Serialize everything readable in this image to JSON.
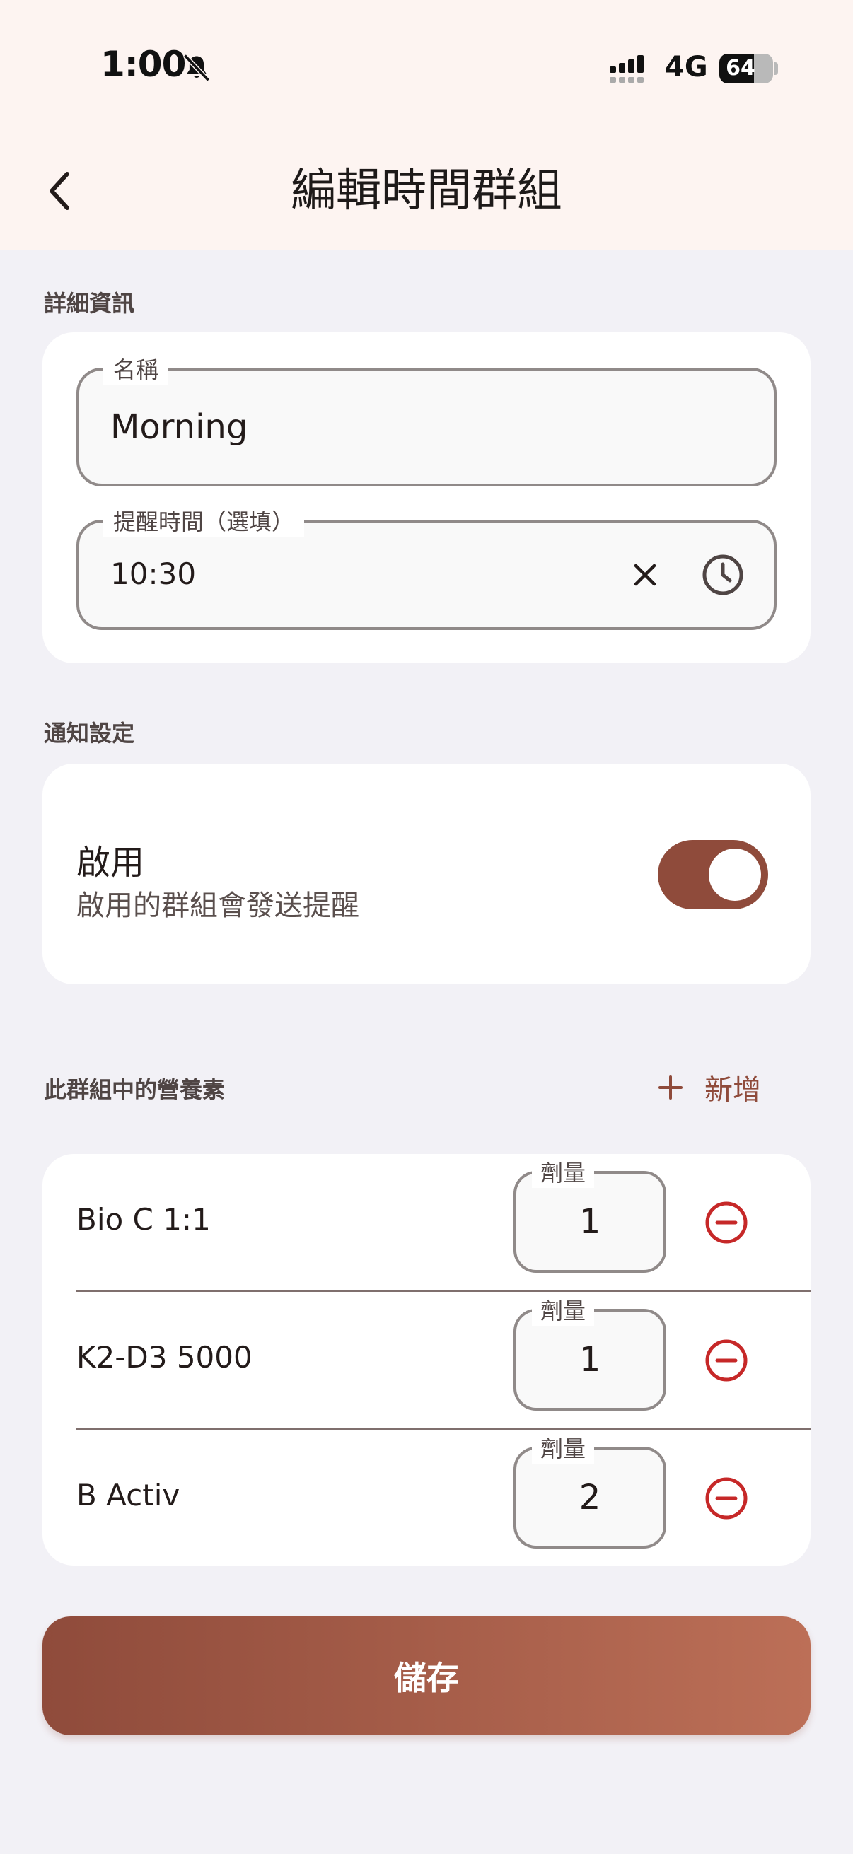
{
  "status_bar": {
    "time": "1:00",
    "network": "4G",
    "battery": "64",
    "battery_fraction": 0.64
  },
  "header": {
    "title": "編輯時間群組"
  },
  "details": {
    "section_label": "詳細資訊",
    "name_field": {
      "label": "名稱",
      "value": "Morning"
    },
    "reminder_field": {
      "label": "提醒時間（選填）",
      "value": "10:30"
    }
  },
  "notification": {
    "section_label": "通知設定",
    "toggle_title": "啟用",
    "toggle_subtitle": "啟用的群組會發送提醒",
    "enabled": true
  },
  "nutrients": {
    "section_label": "此群組中的營養素",
    "add_label": "新增",
    "dose_label": "劑量",
    "items": [
      {
        "name": "Bio C 1:1",
        "dose": "1"
      },
      {
        "name": "K2-D3 5000",
        "dose": "1"
      },
      {
        "name": "B Activ",
        "dose": "2"
      }
    ]
  },
  "save_label": "儲存",
  "colors": {
    "accent": "#8f4b3b",
    "remove": "#c62828",
    "background": "#f2f1f6",
    "header_bg": "#fdf4f1"
  },
  "icons": {
    "back": "chevron-left-icon",
    "bell": "bell-slash-icon",
    "clear": "close-icon",
    "clock": "clock-icon",
    "add": "plus-icon",
    "remove": "minus-circle-icon"
  }
}
